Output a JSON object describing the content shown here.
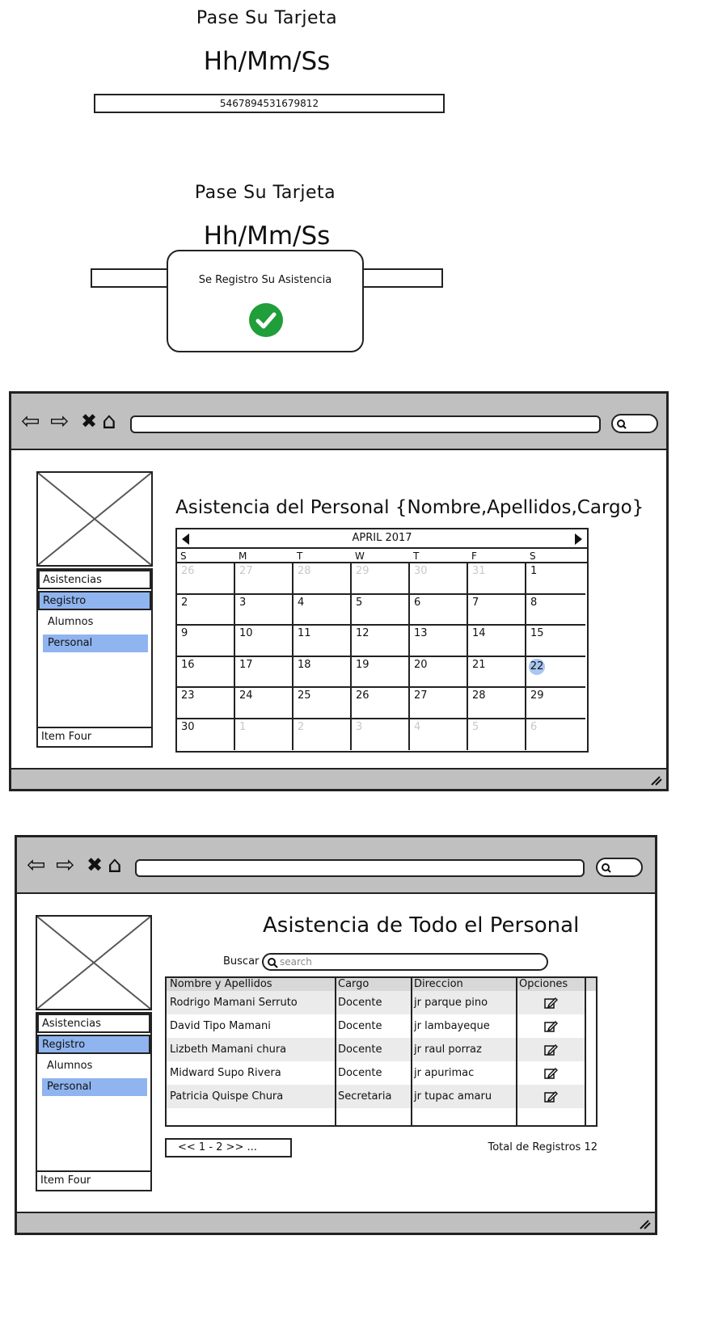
{
  "screen1": {
    "title": "Pase Su Tarjeta",
    "clock": "Hh/Mm/Ss",
    "card_value": "5467894531679812"
  },
  "screen2": {
    "title": "Pase Su Tarjeta",
    "clock": "Hh/Mm/Ss",
    "modal_message": "Se Registro Su Asistencia",
    "modal_icon": "check-circle-icon",
    "modal_icon_color": "#1f9e3a"
  },
  "browser1": {
    "nav_icons": [
      "back-icon",
      "forward-icon",
      "close-icon",
      "home-icon"
    ],
    "sidebar": {
      "items": [
        "Asistencias",
        "Registro"
      ],
      "subitems": [
        "Alumnos",
        "Personal"
      ],
      "footer": "Item Four",
      "selected_color": "#8fb4ef"
    },
    "page_title": "Asistencia del Personal {Nombre,Apellidos,Cargo}",
    "calendar": {
      "month_label": "APRIL 2017",
      "weekdays": [
        "S",
        "M",
        "T",
        "W",
        "T",
        "F",
        "S"
      ],
      "weeks": [
        [
          {
            "d": "26",
            "m": true
          },
          {
            "d": "27",
            "m": true
          },
          {
            "d": "28",
            "m": true
          },
          {
            "d": "29",
            "m": true
          },
          {
            "d": "30",
            "m": true
          },
          {
            "d": "31",
            "m": true
          },
          {
            "d": "1"
          }
        ],
        [
          {
            "d": "2"
          },
          {
            "d": "3"
          },
          {
            "d": "4"
          },
          {
            "d": "5"
          },
          {
            "d": "6"
          },
          {
            "d": "7"
          },
          {
            "d": "8"
          }
        ],
        [
          {
            "d": "9"
          },
          {
            "d": "10"
          },
          {
            "d": "11"
          },
          {
            "d": "12"
          },
          {
            "d": "13"
          },
          {
            "d": "14"
          },
          {
            "d": "15"
          }
        ],
        [
          {
            "d": "16"
          },
          {
            "d": "17"
          },
          {
            "d": "18"
          },
          {
            "d": "19"
          },
          {
            "d": "20"
          },
          {
            "d": "21"
          },
          {
            "d": "22",
            "today": true
          }
        ],
        [
          {
            "d": "23"
          },
          {
            "d": "24"
          },
          {
            "d": "25"
          },
          {
            "d": "26"
          },
          {
            "d": "27"
          },
          {
            "d": "28"
          },
          {
            "d": "29"
          }
        ],
        [
          {
            "d": "30"
          },
          {
            "d": "1",
            "m": true
          },
          {
            "d": "2",
            "m": true
          },
          {
            "d": "3",
            "m": true
          },
          {
            "d": "4",
            "m": true
          },
          {
            "d": "5",
            "m": true
          },
          {
            "d": "6",
            "m": true
          }
        ]
      ],
      "today_color": "#a8c6f2"
    }
  },
  "browser2": {
    "nav_icons": [
      "back-icon",
      "forward-icon",
      "close-icon",
      "home-icon"
    ],
    "sidebar": {
      "items": [
        "Asistencias",
        "Registro"
      ],
      "subitems": [
        "Alumnos",
        "Personal"
      ],
      "footer": "Item Four"
    },
    "page_title": "Asistencia de Todo el Personal",
    "search": {
      "label": "Buscar",
      "placeholder": "search"
    },
    "table": {
      "headers": [
        "Nombre y Apellidos",
        "Cargo",
        "Direccion",
        "Opciones"
      ],
      "rows": [
        [
          "Rodrigo Mamani Serruto",
          "Docente",
          "jr parque pino"
        ],
        [
          "David Tipo Mamani",
          "Docente",
          "jr lambayeque"
        ],
        [
          "Lizbeth Mamani chura",
          "Docente",
          "jr raul porraz"
        ],
        [
          "Midward Supo Rivera",
          "Docente",
          "jr apurimac"
        ],
        [
          "Patricia Quispe Chura",
          "Secretaria",
          "jr tupac amaru"
        ]
      ],
      "row_icon": "edit-icon"
    },
    "pager": "<< 1 - 2 >> ...",
    "total": "Total de Registros 12"
  }
}
